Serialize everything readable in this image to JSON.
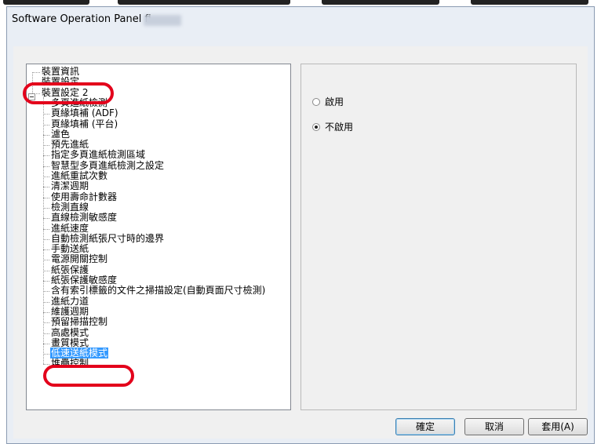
{
  "window": {
    "title": "Software Operation Panel fi-"
  },
  "tree": {
    "items": [
      {
        "label": "裝置資訊",
        "level": 0
      },
      {
        "label": "裝置設定",
        "level": 0
      },
      {
        "label": "裝置設定 2",
        "level": 0,
        "expanded": true
      },
      {
        "label": "多頁進紙檢測",
        "level": 1
      },
      {
        "label": "頁緣填補 (ADF)",
        "level": 1
      },
      {
        "label": "頁緣填補 (平台)",
        "level": 1
      },
      {
        "label": "濾色",
        "level": 1
      },
      {
        "label": "預先進紙",
        "level": 1
      },
      {
        "label": "指定多頁進紙檢測區域",
        "level": 1
      },
      {
        "label": "智慧型多頁進紙檢測之設定",
        "level": 1
      },
      {
        "label": "進紙重試次數",
        "level": 1
      },
      {
        "label": "清潔週期",
        "level": 1
      },
      {
        "label": "使用壽命計數器",
        "level": 1
      },
      {
        "label": "檢測直線",
        "level": 1
      },
      {
        "label": "直線檢測敏感度",
        "level": 1
      },
      {
        "label": "進紙速度",
        "level": 1
      },
      {
        "label": "自動檢測紙張尺寸時的邊界",
        "level": 1
      },
      {
        "label": "手動送紙",
        "level": 1
      },
      {
        "label": "電源開關控制",
        "level": 1
      },
      {
        "label": "紙張保護",
        "level": 1
      },
      {
        "label": "紙張保護敏感度",
        "level": 1
      },
      {
        "label": "含有索引標籤的文件之掃描設定(自動頁面尺寸檢測)",
        "level": 1
      },
      {
        "label": "進紙力道",
        "level": 1
      },
      {
        "label": "維護週期",
        "level": 1
      },
      {
        "label": "預留掃描控制",
        "level": 1
      },
      {
        "label": "高處模式",
        "level": 1
      },
      {
        "label": "畫質模式",
        "level": 1
      },
      {
        "label": "低速送紙模式",
        "level": 1,
        "selected": true
      },
      {
        "label": "堆疊控制",
        "level": 1
      }
    ]
  },
  "options": {
    "radios": [
      {
        "label": "啟用",
        "checked": false
      },
      {
        "label": "不啟用",
        "checked": true
      }
    ]
  },
  "buttons": {
    "ok": "確定",
    "cancel": "取消",
    "apply": "套用(A)"
  },
  "colors": {
    "highlight_ring": "#e3001b",
    "selection": "#3399ff"
  }
}
